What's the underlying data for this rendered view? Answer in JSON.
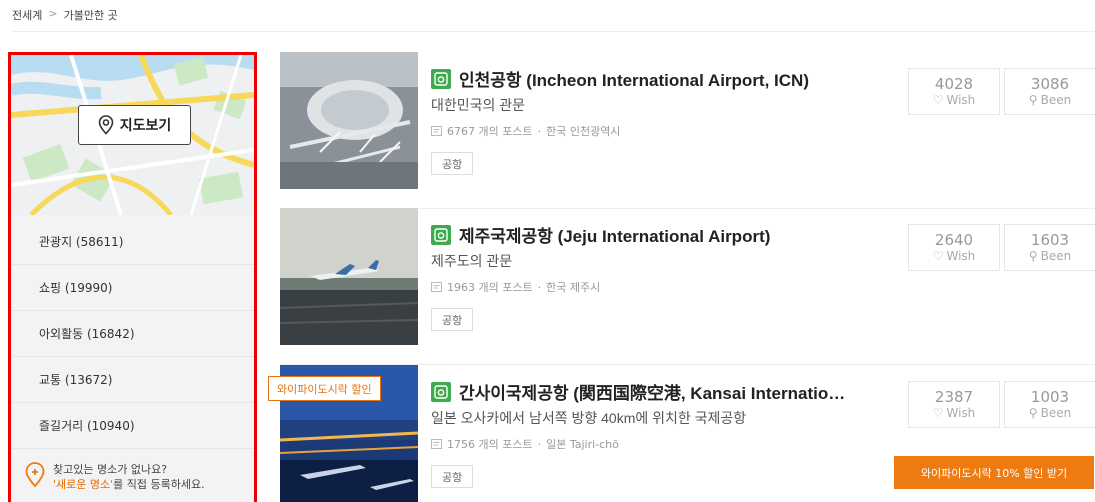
{
  "breadcrumb": [
    "전세계",
    "가볼만한 곳"
  ],
  "breadcrumb_sep": ">",
  "sidebar": {
    "map_button": "지도보기",
    "categories": [
      {
        "label": "관광지 (58611)"
      },
      {
        "label": "쇼핑 (19990)"
      },
      {
        "label": "아외활동 (16842)"
      },
      {
        "label": "교통 (13672)"
      },
      {
        "label": "즐길거리 (10940)"
      }
    ],
    "help_line1": "찾고있는 명소가 없나요?",
    "help_link": "'새로운 명소'",
    "help_line2_rest": "를 직접 등록하세요."
  },
  "places": [
    {
      "title": "인천공항 (Incheon International Airport, ICN)",
      "subtitle": "대한민국의 관문",
      "posts": "6767 개의 포스트",
      "location": "한국 인천광역시",
      "tag": "공항",
      "wish_count": "4028",
      "been_count": "3086"
    },
    {
      "title": "제주국제공항 (Jeju International Airport)",
      "subtitle": "제주도의 관문",
      "posts": "1963 개의 포스트",
      "location": "한국 제주시",
      "tag": "공항",
      "wish_count": "2640",
      "been_count": "1603"
    },
    {
      "title": "간사이국제공항 (関西国際空港, Kansai Internatio…",
      "subtitle": "일본 오사카에서 남서쪽 방향 40km에 위치한 국제공항",
      "posts": "1756 개의 포스트",
      "location": "일본 Tajiri-chō",
      "tag": "공항",
      "wish_count": "2387",
      "been_count": "1003"
    }
  ],
  "labels": {
    "wish": "Wish",
    "been": "Been",
    "dot": "·"
  },
  "promo": {
    "tag": "와이파이도시락 할인",
    "button": "와이파이도시락 10% 할인 받기"
  },
  "colors": {
    "accent": "#ee7a12",
    "green": "#3eaa4d",
    "sidebar_border": "#e00000"
  }
}
